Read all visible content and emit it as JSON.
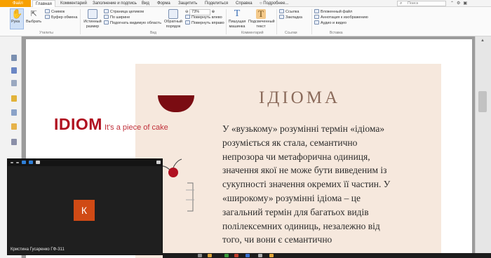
{
  "menubar": {
    "file": "Файл",
    "tabs": [
      "Главная",
      "Комментарий",
      "Заполнение и подпись",
      "Вид",
      "Форма",
      "Защитить",
      "Поделиться",
      "Справка",
      "Подробнее..."
    ],
    "active_tab": "Главная",
    "search_placeholder": "Поиск"
  },
  "ribbon": {
    "hand": "Рука",
    "select": "Выбрать",
    "snapshot": "Снимок",
    "clipboard": "Буфер обмена",
    "group_tools": "Утилиты",
    "actual_size": "Истинный размер",
    "fit_page": "Страница целиком",
    "fit_width": "По ширине",
    "fit_visible": "Подогнать видимую область",
    "reflow": "Обратный порядок",
    "zoom_value": "73%",
    "rotate_left": "Повернуть влево",
    "rotate_right": "Повернуть вправо",
    "group_view": "Вид",
    "typewriter": "Пишущая машинка",
    "highlight": "Подсвеченный текст",
    "group_comment": "Комментарий",
    "link": "Ссылка",
    "bookmark": "Закладка",
    "group_links": "Ссылки",
    "embed_file": "Вложенный файл",
    "image_annotation": "Аннотация к изображению",
    "audio_video": "Аудио и видео",
    "group_insert": "Вставка"
  },
  "document": {
    "heading": "ІДІОМА",
    "idiom_word": "IDIOM",
    "idiom_slogan": "It's a piece of cake",
    "lines": [
      "У «вузькому» розумінні термін «ідіома»",
      "розуміється як стала, семантично",
      "непрозора чи метафорична одиниця,",
      "значення якої не може бути виведеним із",
      "сукупності значення окремих її частин. У",
      "«широкому» розумінні ідіома – це",
      "загальний термін для багатьох видів",
      "полілексемних одиниць, незалежно від",
      "того, чи вони є семантично"
    ]
  },
  "video": {
    "avatar_letter": "К",
    "participant_name": "Кристина Гусаренко ГФ-311"
  },
  "colors": {
    "accent_file": "#f7a000",
    "beige": "#f6e8dd",
    "idiom_red": "#b01020",
    "avatar_bg": "#d04a15"
  }
}
